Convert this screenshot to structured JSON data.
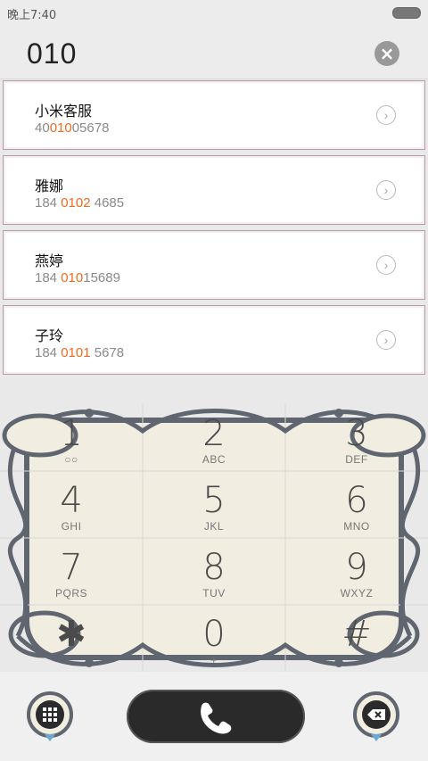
{
  "status_bar": {
    "time": "晚上7:40"
  },
  "search": {
    "query": "010",
    "clear_icon": "close-icon"
  },
  "contacts": [
    {
      "name": "小米客服",
      "num_pre": "40",
      "num_hl": "010",
      "num_post": "05678"
    },
    {
      "name": "雅娜",
      "num_pre": "184 ",
      "num_hl": "0102",
      "num_post": " 4685"
    },
    {
      "name": "燕婷",
      "num_pre": "184 ",
      "num_hl": "010",
      "num_post": "15689"
    },
    {
      "name": "子玲",
      "num_pre": "184 ",
      "num_hl": "0101",
      "num_post": " 5678"
    }
  ],
  "dialpad": {
    "keys": [
      {
        "digit": "1",
        "letters": "○○"
      },
      {
        "digit": "2",
        "letters": "ABC"
      },
      {
        "digit": "3",
        "letters": "DEF"
      },
      {
        "digit": "4",
        "letters": "GHI"
      },
      {
        "digit": "5",
        "letters": "JKL"
      },
      {
        "digit": "6",
        "letters": "MNO"
      },
      {
        "digit": "7",
        "letters": "PQRS"
      },
      {
        "digit": "8",
        "letters": "TUV"
      },
      {
        "digit": "9",
        "letters": "WXYZ"
      },
      {
        "digit": "✱",
        "letters": ""
      },
      {
        "digit": "0",
        "letters": "+"
      },
      {
        "digit": "#",
        "letters": ""
      }
    ]
  },
  "bottom_bar": {
    "dialpad_toggle_icon": "dialpad-grid-icon",
    "call_icon": "phone-icon",
    "delete_icon": "backspace-icon"
  },
  "colors": {
    "highlight": "#f06a1f",
    "frame": "#5f6670",
    "pad_bg": "#f1ede1"
  }
}
